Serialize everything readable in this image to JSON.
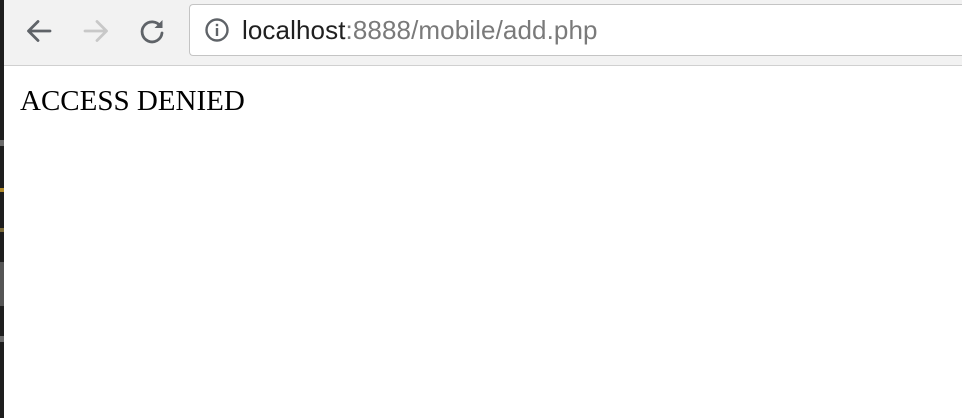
{
  "browser": {
    "url_host": "localhost",
    "url_rest": ":8888/mobile/add.php",
    "icons": {
      "back": "arrow-left-icon",
      "forward": "arrow-right-icon",
      "reload": "reload-icon",
      "site_info": "info-circle-icon"
    },
    "colors": {
      "toolbar_bg": "#f2f2f2",
      "icon_active": "#5f6368",
      "icon_disabled": "#c8c8c8",
      "url_host": "#202020",
      "url_path": "#7a7a7a"
    }
  },
  "page": {
    "message": "ACCESS DENIED"
  }
}
